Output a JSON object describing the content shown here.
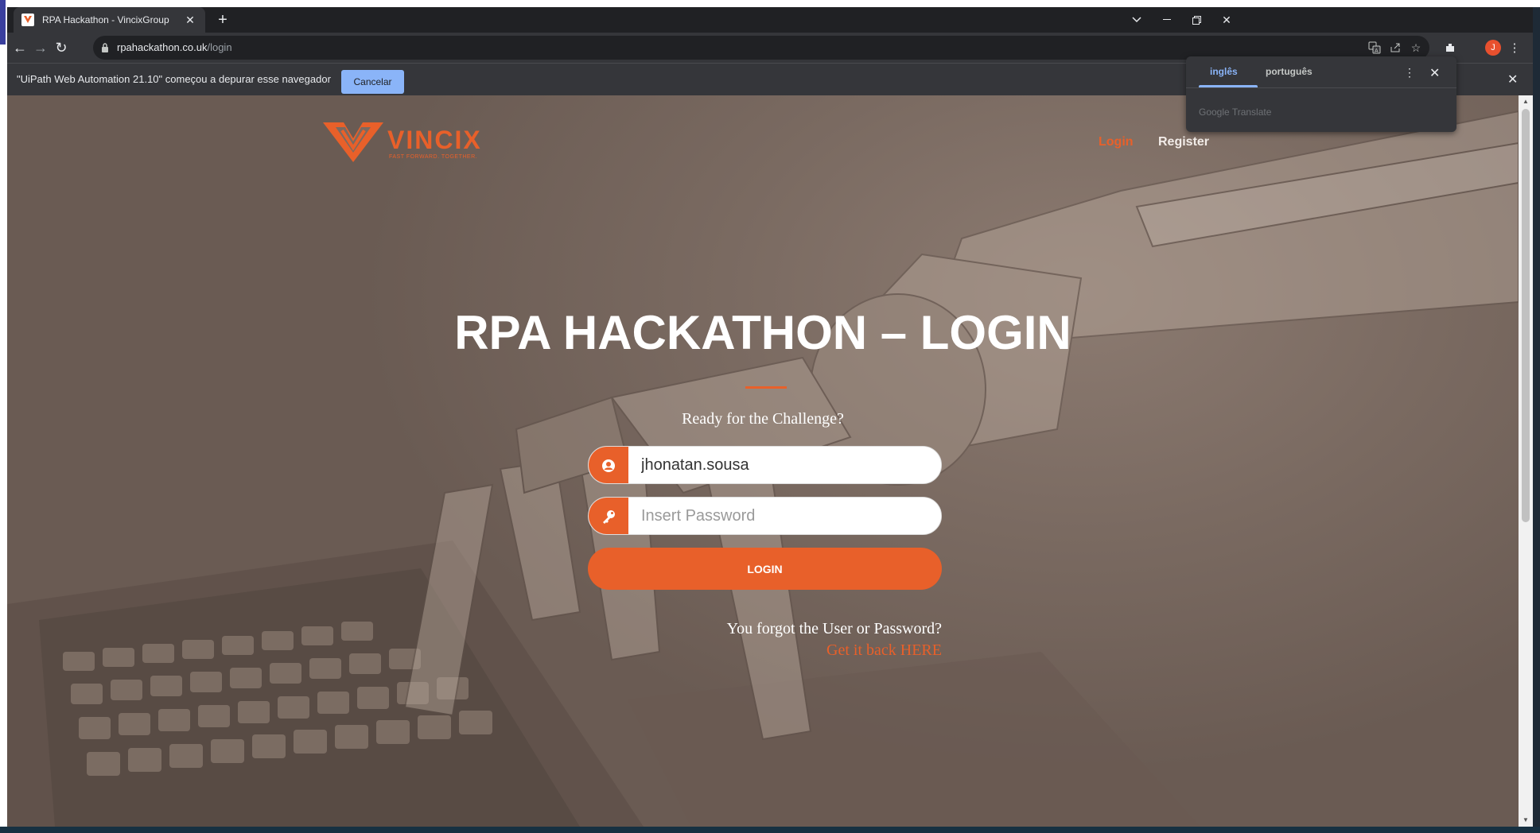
{
  "browser": {
    "tab_title": "RPA Hackathon - VincixGroup",
    "url_host": "rpahackathon.co.uk",
    "url_path": "/login",
    "profile_initial": "J"
  },
  "infobar": {
    "message": "\"UiPath Web Automation 21.10\" começou a depurar esse navegador",
    "cancel_label": "Cancelar"
  },
  "translate": {
    "lang_source": "inglês",
    "lang_target": "português",
    "brand": "Google Translate"
  },
  "site": {
    "logo_word": "VINCIX",
    "logo_tagline": "FAST FORWARD. TOGETHER.",
    "nav_login": "Login",
    "nav_register": "Register"
  },
  "hero": {
    "title": "RPA HACKATHON – LOGIN",
    "subtitle": "Ready for the Challenge?"
  },
  "form": {
    "username_value": "jhonatan.sousa",
    "password_placeholder": "Insert Password",
    "login_button": "LOGIN",
    "forgot_text": "You forgot the User or Password?",
    "recover_link": "Get it back HERE"
  },
  "colors": {
    "accent": "#e8602a",
    "chrome_dark": "#202124",
    "chrome_mid": "#35363a",
    "info_button": "#8ab4f8"
  }
}
